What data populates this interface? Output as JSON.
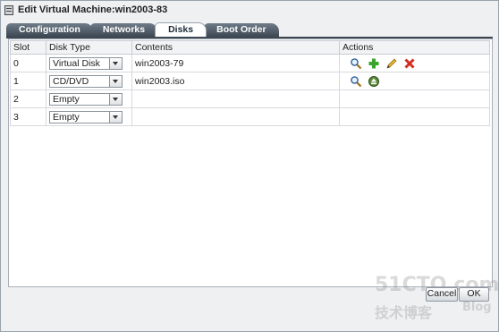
{
  "window": {
    "title": "Edit Virtual Machine:win2003-83"
  },
  "tabs": [
    {
      "label": "Configuration",
      "active": false
    },
    {
      "label": "Networks",
      "active": false
    },
    {
      "label": "Disks",
      "active": true
    },
    {
      "label": "Boot Order",
      "active": false
    }
  ],
  "table": {
    "headers": [
      "Slot",
      "Disk Type",
      "Contents",
      "Actions"
    ],
    "rows": [
      {
        "slot": "0",
        "disk_type": "Virtual Disk",
        "contents": "win2003-79",
        "actions": [
          "search-icon",
          "add-icon",
          "edit-icon",
          "delete-icon"
        ]
      },
      {
        "slot": "1",
        "disk_type": "CD/DVD",
        "contents": "win2003.iso",
        "actions": [
          "search-icon",
          "eject-icon"
        ]
      },
      {
        "slot": "2",
        "disk_type": "Empty",
        "contents": "",
        "actions": []
      },
      {
        "slot": "3",
        "disk_type": "Empty",
        "contents": "",
        "actions": []
      }
    ]
  },
  "footer": {
    "cancel_label": "Cancel",
    "ok_label": "OK"
  },
  "watermark": {
    "line1": "51CTO.com",
    "line2": "技术博客",
    "line3": "Blog"
  },
  "colors": {
    "tab_dark": "#3d4853",
    "panel_border": "#a9b0b8",
    "background": "#eef0f2"
  }
}
